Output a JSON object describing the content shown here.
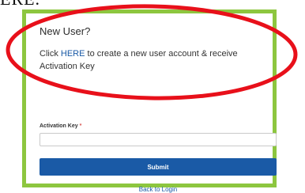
{
  "page": {
    "header_fragment": "ERE."
  },
  "new_user": {
    "title": "New User?",
    "text_before": "Click ",
    "link_text": "HERE",
    "text_after": " to create a new user account & receive Activation Key"
  },
  "form": {
    "activation_key_label": "Activation Key",
    "required_marker": "*",
    "activation_key_value": "",
    "submit_label": "Submit",
    "back_link": "Back to Login"
  },
  "colors": {
    "panel_border": "#8dc63f",
    "accent": "#1a5aa6",
    "highlight": "#e8101a"
  }
}
